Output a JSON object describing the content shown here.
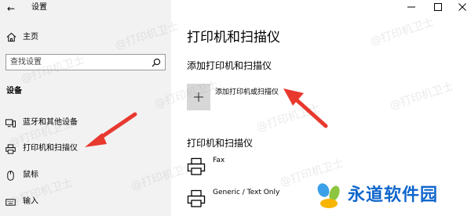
{
  "window": {
    "title": "设置"
  },
  "sidebar": {
    "home_label": "主页",
    "search_placeholder": "查找设置",
    "section_title": "设备",
    "items": [
      {
        "label": "蓝牙和其他设备",
        "icon": "bluetooth-devices-icon"
      },
      {
        "label": "打印机和扫描仪",
        "icon": "printer-icon",
        "active": true
      },
      {
        "label": "鼠标",
        "icon": "mouse-icon"
      },
      {
        "label": "输入",
        "icon": "keyboard-icon"
      }
    ]
  },
  "main": {
    "title": "打印机和扫描仪",
    "add_section_title": "添加打印机和扫描仪",
    "add_button_label": "添加打印机或扫描仪",
    "list_section_title": "打印机和扫描仪",
    "printers": [
      {
        "name": "Fax",
        "icon": "printer-icon"
      },
      {
        "name": "Generic / Text Only",
        "icon": "printer-icon"
      }
    ]
  },
  "watermark": {
    "text": "@打印机卫士"
  },
  "brand": {
    "text": "永道软件园",
    "color": "#0f66cc"
  },
  "colors": {
    "sidebar_bg": "#f2f2f2",
    "add_tile_bg": "#d7d7d7",
    "annotation_red": "#e8392f"
  }
}
